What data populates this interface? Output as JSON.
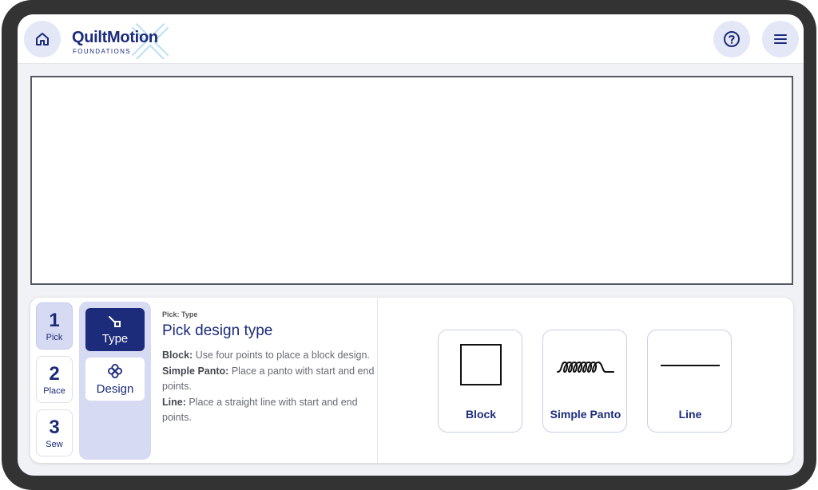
{
  "header": {
    "logo": {
      "name": "QuiltMotion",
      "sub": "FOUNDATIONS",
      "mark": "X"
    },
    "home_icon": "home-icon",
    "help_icon": "help-circle-icon",
    "menu_icon": "hamburger-menu-icon"
  },
  "steps": [
    {
      "number": "1",
      "label": "Pick",
      "active": true
    },
    {
      "number": "2",
      "label": "Place",
      "active": false
    },
    {
      "number": "3",
      "label": "Sew",
      "active": false
    }
  ],
  "substeps": [
    {
      "label": "Type",
      "icon": "type-shape-icon",
      "active": true
    },
    {
      "label": "Design",
      "icon": "flower-icon",
      "active": false
    }
  ],
  "info": {
    "crumb": "Pick: Type",
    "title": "Pick design type",
    "items": [
      {
        "term": "Block:",
        "desc": "Use four points to place a block design."
      },
      {
        "term": "Simple Panto:",
        "desc": "Place a panto with start and end points."
      },
      {
        "term": "Line:",
        "desc": "Place a straight line with start and end points."
      }
    ]
  },
  "options": [
    {
      "label": "Block",
      "icon": "square-icon"
    },
    {
      "label": "Simple Panto",
      "icon": "loops-icon"
    },
    {
      "label": "Line",
      "icon": "line-icon"
    }
  ],
  "colors": {
    "brand": "#1c2b7a",
    "accent_light": "#d6daf3",
    "frame": "#333333"
  }
}
